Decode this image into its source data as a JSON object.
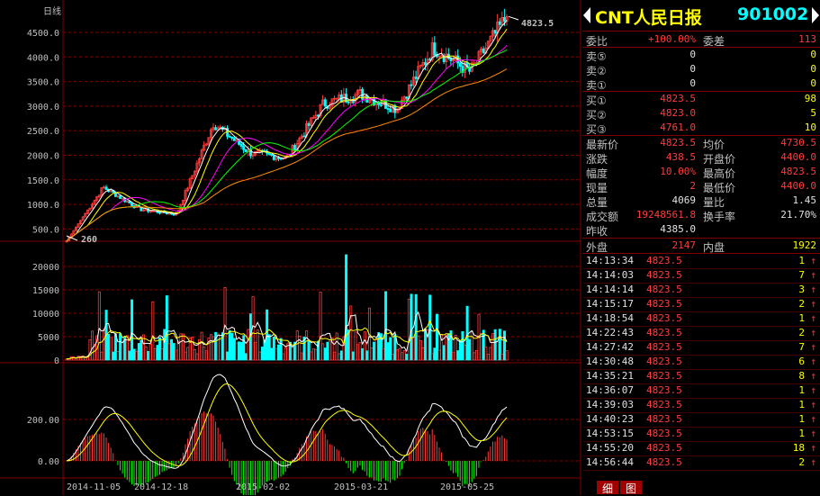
{
  "chart": {
    "period_label": "日线",
    "start_label": "260",
    "last_price_label": "4823.5",
    "price_axis": [
      "4500.0",
      "4000.0",
      "3500.0",
      "3000.0",
      "2500.0",
      "2000.0",
      "1500.0",
      "1000.0",
      "500.0"
    ],
    "vol_axis": [
      "20000",
      "15000",
      "10000",
      "5000",
      "0"
    ],
    "macd_axis": [
      "200.00",
      "0.00"
    ],
    "dates": [
      "2014-11-05",
      "2014-12-18",
      "2015-02-02",
      "2015-03-21",
      "2015-05-25"
    ],
    "colors": {
      "up": "#ff3b3b",
      "down": "#00ffff",
      "grid": "#800000",
      "ma1": "#ffffff",
      "ma2": "#ffff00",
      "ma3": "#ff00ff",
      "ma4": "#00ff00",
      "ma5": "#ff8c00"
    }
  },
  "chart_data": {
    "type": "line",
    "x": [
      "2014-11-05",
      "2014-12-18",
      "2015-02-02",
      "2015-03-21",
      "2015-05-25"
    ],
    "series": [
      {
        "values": [
          260,
          1350,
          900,
          800,
          2650,
          2050,
          1950,
          3050,
          3250,
          2950,
          4200,
          3700,
          4823.5
        ]
      }
    ],
    "ylim": [
      260,
      4823.5
    ]
  },
  "quote": {
    "name": "CNT人民日报",
    "code": "901002",
    "rows": [
      {
        "l1": "委比",
        "v1": "+100.00%",
        "l2": "委差",
        "v2": "113"
      }
    ],
    "sell": [
      {
        "l": "卖⑤",
        "p": "0",
        "q": "0"
      },
      {
        "l": "卖②",
        "p": "0",
        "q": "0"
      },
      {
        "l": "卖①",
        "p": "0",
        "q": "0"
      }
    ],
    "buy": [
      {
        "l": "买①",
        "p": "4823.5",
        "q": "98"
      },
      {
        "l": "买②",
        "p": "4823.0",
        "q": "5"
      },
      {
        "l": "买③",
        "p": "4761.0",
        "q": "10"
      }
    ],
    "stats": [
      {
        "l1": "最新价",
        "v1": "4823.5",
        "l2": "均价",
        "v2": "4730.5"
      },
      {
        "l1": "涨跌",
        "v1": "438.5",
        "l2": "开盘价",
        "v2": "4400.0"
      },
      {
        "l1": "幅度",
        "v1": "10.00%",
        "l2": "最高价",
        "v2": "4823.5"
      },
      {
        "l1": "现量",
        "v1": "2",
        "l2": "最低价",
        "v2": "4400.0"
      },
      {
        "l1": "总量",
        "v1": "4069",
        "l2": "量比",
        "v2": "1.45"
      },
      {
        "l1": "成交额",
        "v1": "19248561.8",
        "l2": "换手率",
        "v2": "21.70%"
      },
      {
        "l1": "昨收",
        "v1": "4385.0",
        "l2": "",
        "v2": ""
      }
    ],
    "outer": {
      "l1": "外盘",
      "v1": "2147",
      "l2": "内盘",
      "v2": "1922"
    },
    "ticks": [
      {
        "t": "14:13:34",
        "p": "4823.5",
        "q": "1"
      },
      {
        "t": "14:14:03",
        "p": "4823.5",
        "q": "7"
      },
      {
        "t": "14:14:14",
        "p": "4823.5",
        "q": "3"
      },
      {
        "t": "14:15:17",
        "p": "4823.5",
        "q": "2"
      },
      {
        "t": "14:18:54",
        "p": "4823.5",
        "q": "1"
      },
      {
        "t": "14:22:43",
        "p": "4823.5",
        "q": "2"
      },
      {
        "t": "14:27:42",
        "p": "4823.5",
        "q": "7"
      },
      {
        "t": "14:30:48",
        "p": "4823.5",
        "q": "6"
      },
      {
        "t": "14:35:21",
        "p": "4823.5",
        "q": "8"
      },
      {
        "t": "14:36:07",
        "p": "4823.5",
        "q": "1"
      },
      {
        "t": "14:39:03",
        "p": "4823.5",
        "q": "1"
      },
      {
        "t": "14:40:23",
        "p": "4823.5",
        "q": "1"
      },
      {
        "t": "14:53:15",
        "p": "4823.5",
        "q": "1"
      },
      {
        "t": "14:55:20",
        "p": "4823.5",
        "q": "18"
      },
      {
        "t": "14:56:44",
        "p": "4823.5",
        "q": "2"
      }
    ],
    "tabs": [
      "细",
      "图"
    ]
  }
}
